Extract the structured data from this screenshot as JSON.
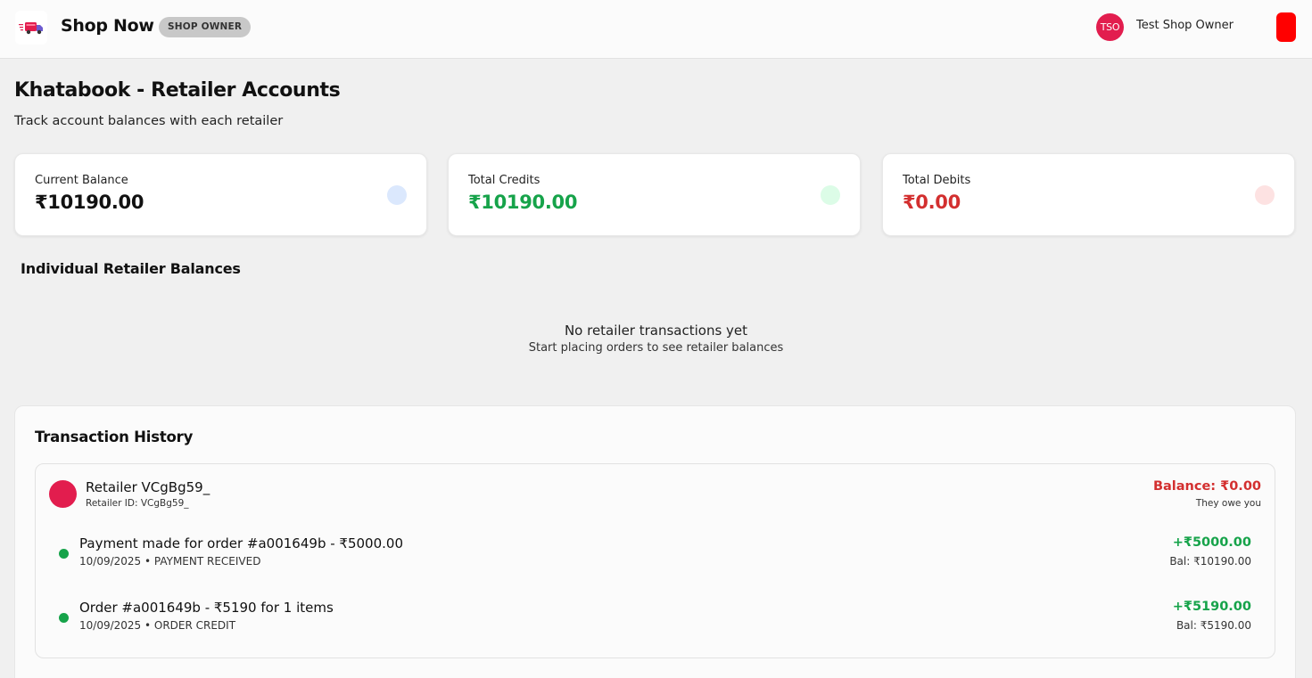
{
  "header": {
    "brand": "Shop Now",
    "role_badge": "SHOP OWNER",
    "avatar_initials": "TSO",
    "user_name": "Test Shop Owner",
    "logo_icon": "delivery-truck-icon",
    "accent_color": "#e21d4e",
    "logout_color": "#ff0000"
  },
  "page": {
    "title": "Khatabook - Retailer Accounts",
    "subtitle": "Track account balances with each retailer"
  },
  "stats": [
    {
      "label": "Current Balance",
      "value": "₹10190.00",
      "value_color": "#111111",
      "dot_color": "#dbe8fd"
    },
    {
      "label": "Total Credits",
      "value": "₹10190.00",
      "value_color": "#16a34a",
      "dot_color": "#dcfce7"
    },
    {
      "label": "Total Debits",
      "value": "₹0.00",
      "value_color": "#d32f2f",
      "dot_color": "#fde2e2"
    }
  ],
  "retailer_balances": {
    "title": "Individual Retailer Balances",
    "empty_title": "No retailer transactions yet",
    "empty_subtitle": "Start placing orders to see retailer balances"
  },
  "history": {
    "title": "Transaction History",
    "retailer": {
      "name": "Retailer VCgBg59_",
      "id_line": "Retailer ID: VCgBg59_",
      "balance": "Balance: ₹0.00",
      "owe_text": "They owe you"
    },
    "transactions": [
      {
        "description": "Payment made for order #a001649b - ₹5000.00",
        "meta": "10/09/2025 • PAYMENT RECEIVED",
        "amount": "+₹5000.00",
        "balance": "Bal: ₹10190.00"
      },
      {
        "description": "Order #a001649b - ₹5190 for 1 items",
        "meta": "10/09/2025 • ORDER CREDIT",
        "amount": "+₹5190.00",
        "balance": "Bal: ₹5190.00"
      }
    ]
  }
}
